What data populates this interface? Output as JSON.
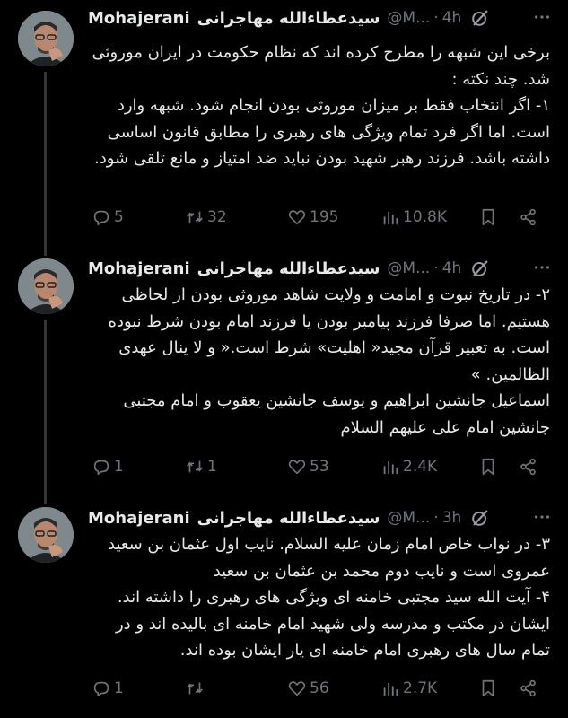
{
  "tweets": [
    {
      "author_name": "Mohajerani",
      "author_name_fa": "سیدعطاءالله مهاجرانی",
      "handle": "@M...",
      "separator": "·",
      "time": "4h",
      "body": [
        "برخی این شبهه را مطرح کرده اند که نظام حکومت در ایران موروثی شد. چند نکته :",
        "۱- اگر انتخاب فقط بر میزان موروثی بودن انجام شود. شبهه وارد است. اما اگر فرد تمام ویژگی های رهبری را مطابق قانون اساسی داشته باشد. فرزند رهبر شهید بودن نباید ضد امتیاز و مانع تلقی شود."
      ],
      "replies": "5",
      "retweets": "32",
      "likes": "195",
      "views": "10.8K"
    },
    {
      "author_name": "Mohajerani",
      "author_name_fa": "سیدعطاءالله مهاجرانی",
      "handle": "@M...",
      "separator": "·",
      "time": "4h",
      "body": [
        "۲- در تاریخ نبوت و امامت و ولایت شاهد موروثی بودن از لحاظی هستیم. اما صرفا فرزند پیامبر بودن یا فرزند امام بودن شرط نبوده است. به تعبیر قرآن مجید« اهلیت» شرط است.« و لا ینال عهدی الظالمین. »",
        "اسماعیل جانشین ابراهیم و یوسف جانشین یعقوب و امام مجتبی جانشین امام علی علیهم السلام"
      ],
      "replies": "1",
      "retweets": "1",
      "likes": "53",
      "views": "2.4K"
    },
    {
      "author_name": "Mohajerani",
      "author_name_fa": "سیدعطاءالله مهاجرانی",
      "handle": "@M...",
      "separator": "·",
      "time": "3h",
      "body": [
        "۳- در نواب خاص امام زمان علیه السلام. نایب اول عثمان بن سعید عمروی است و نایب دوم محمد بن عثمان بن سعید",
        "۴- آیت الله سید مجتبی خامنه ای ویژگی های رهبری را داشته اند. ایشان در مکتب و مدرسه ولی شهید امام خامنه ای بالیده اند و در تمام سال های رهبری امام خامنه ای یار ایشان بوده اند."
      ],
      "replies": "1",
      "retweets": "",
      "likes": "56",
      "views": "2.7K"
    }
  ],
  "colors": {
    "background": "#000000",
    "text": "#e7e9ea",
    "secondary": "#71767b",
    "thread_line": "#333639"
  },
  "icons": [
    "avatar",
    "grok-icon",
    "more-icon",
    "reply-icon",
    "retweet-icon",
    "like-icon",
    "views-icon",
    "bookmark-icon",
    "share-icon"
  ]
}
